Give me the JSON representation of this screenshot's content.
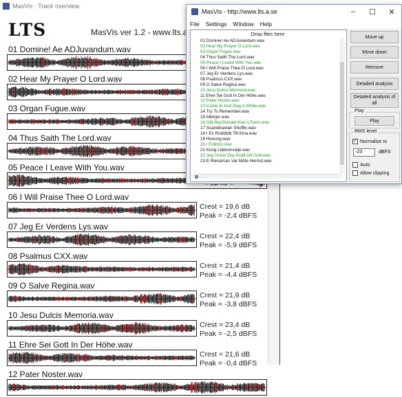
{
  "background_window": {
    "title": "MasVis - Track overview",
    "logo_text": "LTS",
    "version": "MasVis ver 1.2 - www.lts.a.se",
    "tracks": [
      {
        "title": "01 Domine! Ae ADJuvandum.wav",
        "crest": "",
        "peak": ""
      },
      {
        "title": "02 Hear My Prayer  O Lord.wav",
        "crest": "",
        "peak": ""
      },
      {
        "title": "03 Organ Fugue.wav",
        "crest": "",
        "peak": ""
      },
      {
        "title": "04 Thus Saith The Lord.wav",
        "crest": "",
        "peak": ""
      },
      {
        "title": "05 Peace I Leave With You.wav",
        "crest": "",
        "peak": ""
      },
      {
        "title": "06 I Will Praise Thee  O Lord.wav",
        "crest": "Crest = 19,6 dB",
        "peak": "Peak = -2,4 dBFS"
      },
      {
        "title": "07 Jeg Er Verdens Lys.wav",
        "crest": "Crest = 22,4 dB",
        "peak": "Peak = -5,9 dBFS"
      },
      {
        "title": "08 Psalmus CXX.wav",
        "crest": "Crest = 21,4 dB",
        "peak": "Peak = -4,4 dBFS"
      },
      {
        "title": "09 O  Salve Regina.wav",
        "crest": "Crest = 21,9 dB",
        "peak": "Peak = -3,8 dBFS"
      },
      {
        "title": "10 Jesu Dulcis Memoria.wav",
        "crest": "Crest = 23,4 dB",
        "peak": "Peak = -2,5 dBFS"
      },
      {
        "title": "11 Ehre Sei Gott In Der Höhe.wav",
        "crest": "Crest = 21,6 dB",
        "peak": "Peak = -0,4 dBFS"
      },
      {
        "title": "12 Pater Noster.wav",
        "crest": "",
        "peak": ""
      }
    ]
  },
  "dialog": {
    "title": "MasVis - http://www.lts.a.se",
    "menu": [
      "File",
      "Settings",
      "Window",
      "Help"
    ],
    "drop_label": "Drop files here",
    "files": [
      {
        "name": "01 Domine! Ae ADJuvandum.wav",
        "green": false
      },
      {
        "name": "02 Hear My Prayer  O Lord.wav",
        "green": true
      },
      {
        "name": "03 Organ Fugue.wav",
        "green": true
      },
      {
        "name": "04 Thus Saith The Lord.wav",
        "green": false
      },
      {
        "name": "05 Peace I Leave With You.wav",
        "green": true
      },
      {
        "name": "06 I Will Praise Thee  O Lord.wav",
        "green": false
      },
      {
        "name": "07 Jeg Er Verdens Lys.wav",
        "green": false
      },
      {
        "name": "08 Psalmus CXX.wav",
        "green": false
      },
      {
        "name": "09 O  Salve Regina.wav",
        "green": false
      },
      {
        "name": "10 Jesu Dulcis Memoria.wav",
        "green": true
      },
      {
        "name": "11 Ehre Sei Gott In Der Höhe.wav",
        "green": false
      },
      {
        "name": "12 Pater Noster.wav",
        "green": true
      },
      {
        "name": "13 Come In And Stay A While.wav",
        "green": true
      },
      {
        "name": "14 Try To Remember.wav",
        "green": false
      },
      {
        "name": "15 Allergic.wav",
        "green": false
      },
      {
        "name": "16 Old MacDonald Had A Farm.wav",
        "green": true
      },
      {
        "name": "17 Scandinavian Shuffle.wav",
        "green": false
      },
      {
        "name": "18 I En Roddbåt Till Kina.wav",
        "green": false
      },
      {
        "name": "19 Honung.wav",
        "green": false
      },
      {
        "name": "20 I Folkton.wav",
        "green": true
      },
      {
        "name": "21 Kung Liljekonvalje.wav",
        "green": false
      },
      {
        "name": "22 Jeg Unnar Dig Ändå Allt Gott.wav",
        "green": true
      },
      {
        "name": "23 E Riesarnas Var Möte Herrnd.wav",
        "green": false
      }
    ],
    "buttons": {
      "move_up": "Move up",
      "move_down": "Move down",
      "remove": "Remove",
      "detailed_analysis": "Detailed analysis",
      "detailed_analysis_all": "Detailed analysis of all",
      "play": "Play"
    },
    "play_group": "Play",
    "rms_group": "RMS level",
    "normalize_label": "Normalize to",
    "normalize_checked": true,
    "normalize_value": "-23",
    "normalize_unit": "dBFS",
    "auto_label": "Auto",
    "auto_checked": false,
    "allow_clipping_label": "Allow clipping",
    "allow_clipping_checked": false
  },
  "colors": {
    "waveform": "#111111",
    "waveform_peak": "#b31212",
    "green_item": "#2a9a2a"
  }
}
